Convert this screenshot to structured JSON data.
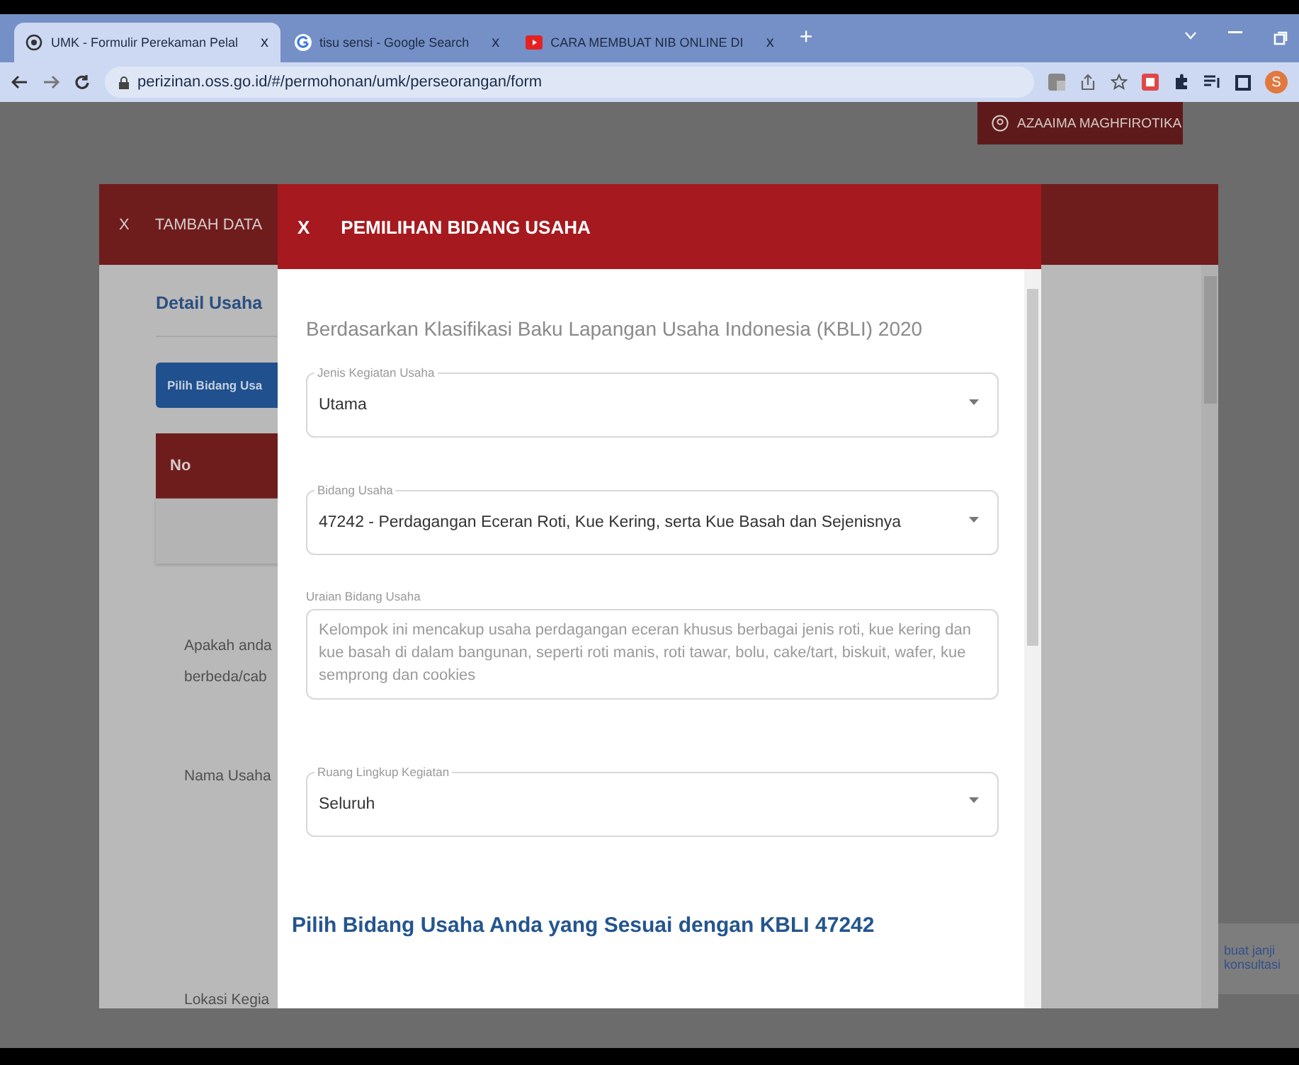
{
  "browser": {
    "tabs": [
      {
        "title": "UMK - Formulir Perekaman Pelal",
        "selected": true,
        "close": "x"
      },
      {
        "title": "tisu sensi - Google Search",
        "selected": false,
        "close": "x"
      },
      {
        "title": "CARA MEMBUAT NIB ONLINE DI",
        "selected": false,
        "close": "x"
      }
    ],
    "new_tab": "+",
    "address": "perizinan.oss.go.id/#/permohonan/umk/perseorangan/form",
    "profile_initial": "S"
  },
  "page": {
    "user_name": "AZAAIMA MAGHFIROTIKA",
    "side_link": [
      "buat janji",
      "konsultasi"
    ]
  },
  "back_modal": {
    "close": "X",
    "title": "TAMBAH DATA",
    "section_title": "Detail Usaha",
    "button_label": "Pilih Bidang Usa",
    "table_column": "No",
    "questions": [
      "Apakah anda",
      "berbeda/cab",
      "Nama Usaha",
      "Lokasi Kegia"
    ]
  },
  "front_modal": {
    "close": "X",
    "title": "PEMILIHAN BIDANG USAHA",
    "subtitle": "Berdasarkan Klasifikasi Baku Lapangan Usaha Indonesia (KBLI) 2020",
    "fields": [
      {
        "kind": "select",
        "label": "Jenis Kegiatan Usaha",
        "value": "Utama"
      },
      {
        "kind": "select",
        "label": "Bidang Usaha",
        "value": "47242 - Perdagangan Eceran Roti, Kue Kering, serta Kue Basah dan Sejenisnya"
      },
      {
        "kind": "textarea",
        "label": "Uraian Bidang Usaha",
        "value": "Kelompok ini mencakup usaha perdagangan eceran khusus berbagai jenis roti, kue kering dan kue basah di dalam bangunan, seperti roti manis, roti tawar, bolu, cake/tart, biskuit, wafer, kue semprong dan cookies"
      },
      {
        "kind": "select",
        "label": "Ruang Lingkup Kegiatan",
        "value": "Seluruh"
      }
    ],
    "heading": "Pilih Bidang Usaha Anda yang Sesuai dengan KBLI 47242"
  }
}
